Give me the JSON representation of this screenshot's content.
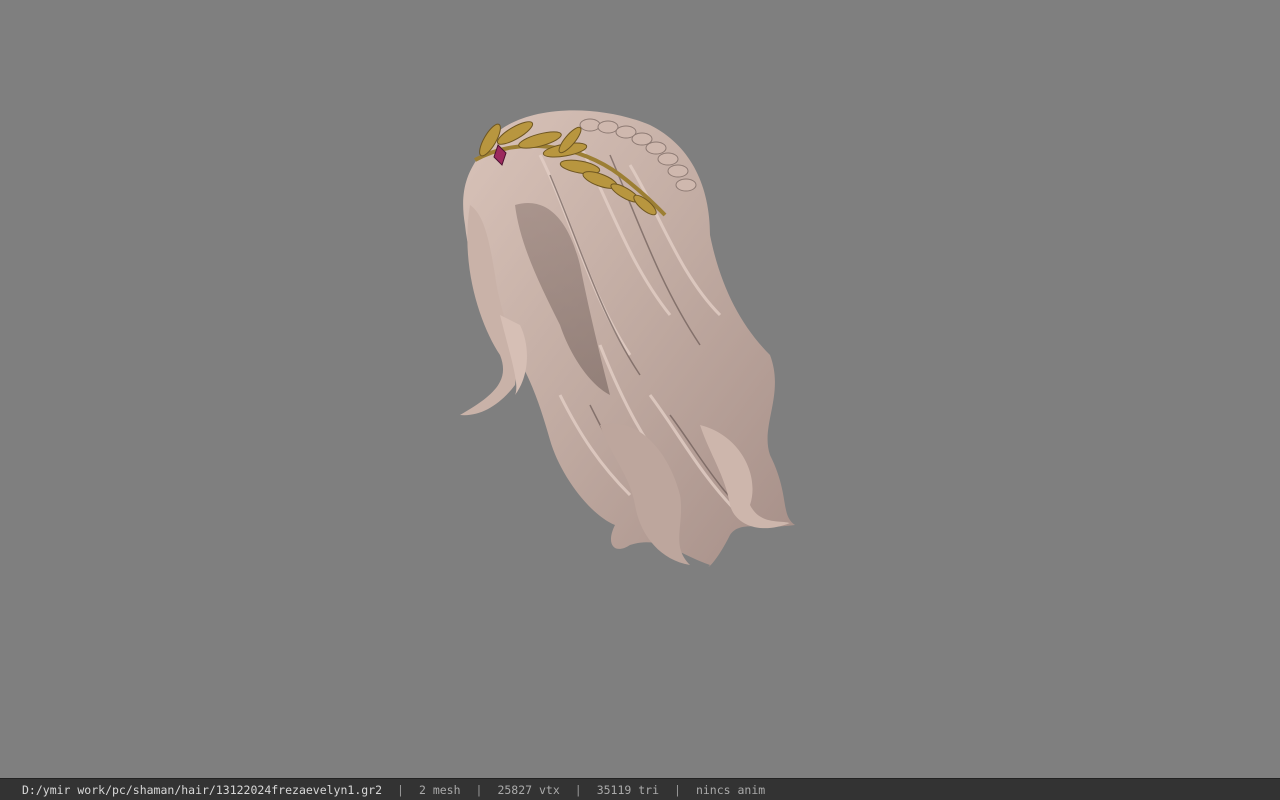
{
  "viewport": {
    "background_color": "#7f7f7f",
    "model_name": "frezaevelyn1 hair model"
  },
  "statusbar": {
    "file_path": "D:/ymir work/pc/shaman/hair/13122024frezaevelyn1.gr2",
    "separator": "|",
    "mesh_count": "2 mesh",
    "vertex_count": "25827 vtx",
    "triangle_count": "35119 tri",
    "anim_status": "nincs anim"
  },
  "colors": {
    "hair_light": "#d8bfb4",
    "hair_mid": "#b8a29a",
    "hair_dark": "#7d6a64",
    "gold": "#b8963f",
    "jewel": "#9c2a5e"
  }
}
